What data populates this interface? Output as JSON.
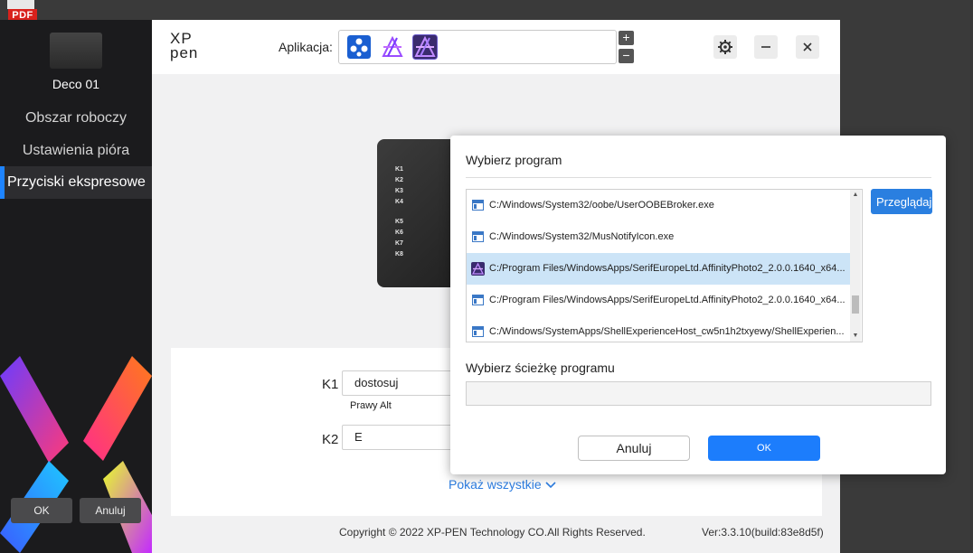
{
  "desktop": {
    "pdf_icon_label": "PDF"
  },
  "sidebar": {
    "device_name": "Deco 01",
    "items": [
      {
        "label": "Obszar roboczy",
        "active": false
      },
      {
        "label": "Ustawienia pióra",
        "active": false
      },
      {
        "label": "Przyciski ekspresowe",
        "active": true
      }
    ],
    "ok_label": "OK",
    "cancel_label": "Anuluj"
  },
  "header": {
    "brand_line1": "XP",
    "brand_line2": "pen",
    "app_label": "Aplikacja:",
    "add_label": "+",
    "remove_label": "−"
  },
  "tablet": {
    "keys": [
      "K1",
      "K2",
      "K3",
      "K4",
      "K5",
      "K6",
      "K7",
      "K8"
    ]
  },
  "settings": {
    "k1_label": "K1",
    "k1_value": "dostosuj",
    "k1_sub": "Prawy Alt",
    "k2_label": "K2",
    "k2_value": "E",
    "show_all": "Pokaż wszystkie"
  },
  "footer": {
    "copyright": "Copyright © 2022  XP-PEN Technology CO.All Rights Reserved.",
    "version": "Ver:3.3.10(build:83e8d5f)"
  },
  "dialog": {
    "title": "Wybierz program",
    "programs": [
      {
        "path": "C:/Windows/System32/oobe/UserOOBEBroker.exe",
        "icon": "window-icon",
        "selected": false
      },
      {
        "path": "C:/Windows/System32/MusNotifyIcon.exe",
        "icon": "window-icon",
        "selected": false
      },
      {
        "path": "C:/Program Files/WindowsApps/SerifEuropeLtd.AffinityPhoto2_2.0.0.1640_x64...",
        "icon": "affinity-photo-icon",
        "selected": true
      },
      {
        "path": "C:/Program Files/WindowsApps/SerifEuropeLtd.AffinityPhoto2_2.0.0.1640_x64...",
        "icon": "window-icon",
        "selected": false
      },
      {
        "path": "C:/Windows/SystemApps/ShellExperienceHost_cw5n1h2txyewy/ShellExperien...",
        "icon": "window-icon",
        "selected": false
      }
    ],
    "browse_label": "Przeglądaj",
    "path_label": "Wybierz ścieżkę programu",
    "path_value": "",
    "cancel_label": "Anuluj",
    "ok_label": "OK"
  },
  "colors": {
    "accent": "#1c7dfc",
    "sidebar_bg": "#1b1b1d",
    "selected_row": "#cce4f7"
  }
}
